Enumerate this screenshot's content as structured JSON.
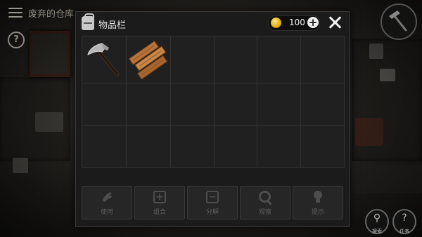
{
  "hud": {
    "location_title": "废弃的仓库",
    "help_glyph": "?"
  },
  "inventory": {
    "title": "物品栏",
    "coin_count": "100",
    "add_glyph": "+",
    "items": [
      {
        "name": "hammer",
        "icon": "hammer-icon"
      },
      {
        "name": "wooden-planks",
        "icon": "wood-planks-icon"
      }
    ],
    "actions": [
      {
        "label": "使用",
        "icon": "hand-icon"
      },
      {
        "label": "组合",
        "icon": "combine-icon"
      },
      {
        "label": "分解",
        "icon": "split-icon"
      },
      {
        "label": "观察",
        "icon": "magnifier-icon"
      },
      {
        "label": "提示",
        "icon": "lightbulb-icon"
      }
    ]
  },
  "side_buttons": {
    "search_label": "搜索",
    "task_label": "任务",
    "task_glyph": "?"
  },
  "colors": {
    "coin": "#d9a400",
    "panel_bg": "#1b1b1b",
    "disabled_text": "#5e5e5e"
  }
}
